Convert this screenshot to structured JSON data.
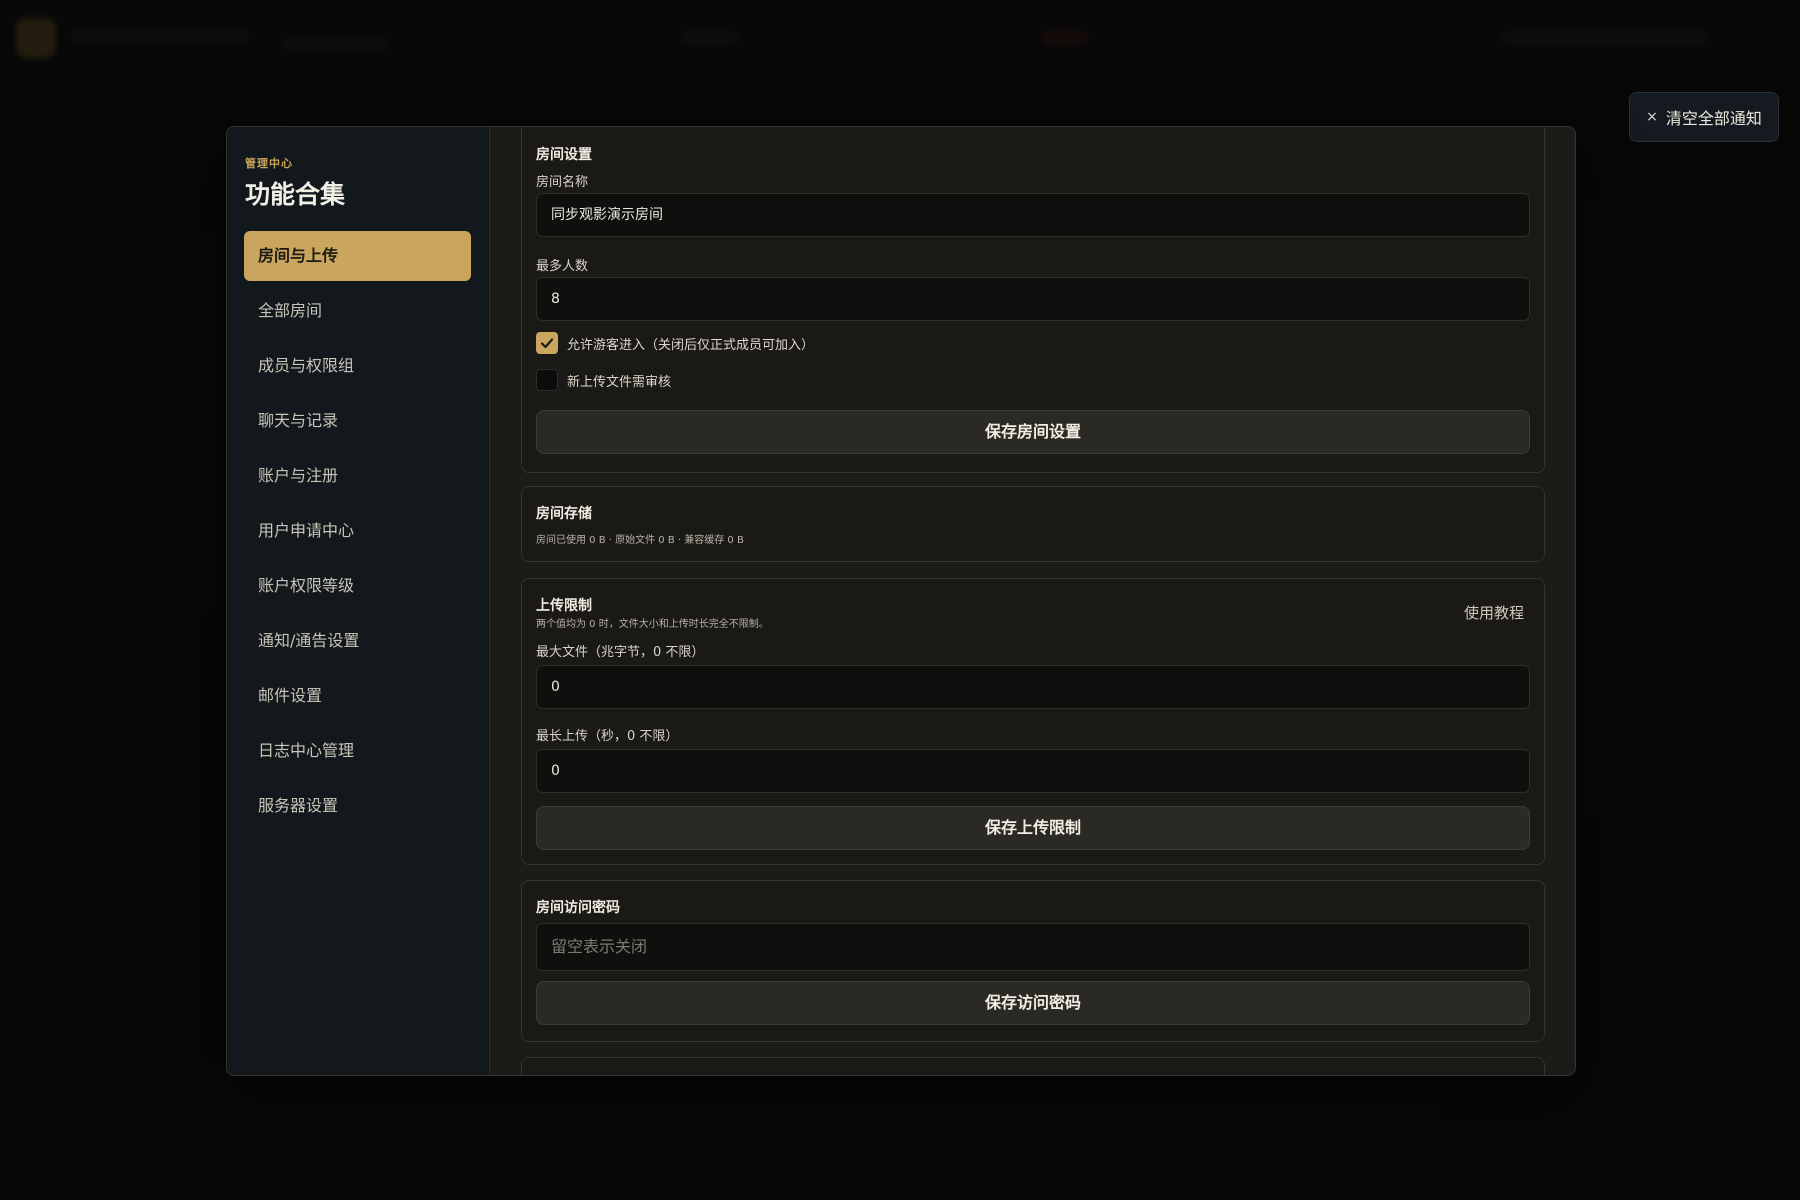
{
  "toast": {
    "close_icon": "×",
    "label": "清空全部通知"
  },
  "sidebar": {
    "eyebrow": "管理中心",
    "title": "功能合集",
    "items": [
      {
        "label": "房间与上传",
        "active": true
      },
      {
        "label": "全部房间"
      },
      {
        "label": "成员与权限组"
      },
      {
        "label": "聊天与记录"
      },
      {
        "label": "账户与注册"
      },
      {
        "label": "用户申请中心"
      },
      {
        "label": "账户权限等级"
      },
      {
        "label": "通知/通告设置"
      },
      {
        "label": "邮件设置"
      },
      {
        "label": "日志中心管理"
      },
      {
        "label": "服务器设置"
      }
    ]
  },
  "room_settings": {
    "title": "房间设置",
    "name_label": "房间名称",
    "name_value": "同步观影演示房间",
    "max_label": "最多人数",
    "max_value": "8",
    "guest_label": "允许游客进入（关闭后仅正式成员可加入）",
    "guest_checked": true,
    "review_label": "新上传文件需审核",
    "review_checked": false,
    "save_label": "保存房间设置"
  },
  "storage": {
    "title": "房间存储",
    "info": "房间已使用 0 B · 原始文件 0 B · 兼容缓存 0 B"
  },
  "upload_limit": {
    "title": "上传限制",
    "desc": "两个值均为 0 时，文件大小和上传时长完全不限制。",
    "tutorial_label": "使用教程",
    "max_file_label": "最大文件（兆字节，0 不限）",
    "max_file_value": "0",
    "max_duration_label": "最长上传（秒，0 不限）",
    "max_duration_value": "0",
    "save_label": "保存上传限制"
  },
  "access_password": {
    "title": "房间访问密码",
    "placeholder": "留空表示关闭",
    "save_label": "保存访问密码"
  },
  "colors": {
    "accent": "#c9a55d",
    "sidebar_bg": "#12181c",
    "modal_bg": "#1c1b17"
  }
}
